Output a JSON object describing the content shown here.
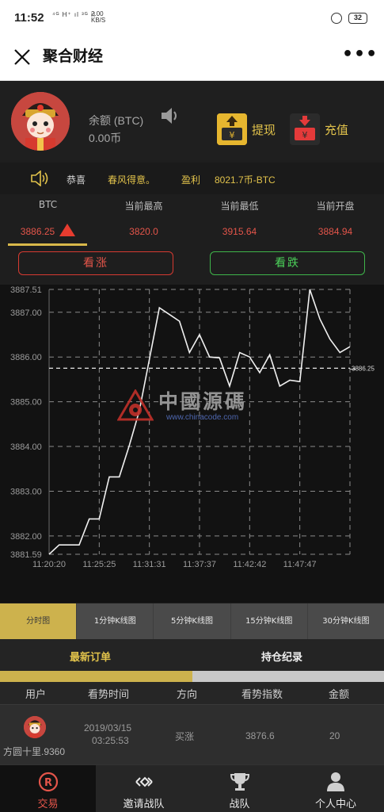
{
  "status_bar": {
    "time": "11:52",
    "network": "⁴ᴳ H⁺ ıl ³ᴳ ıl",
    "speed_top": "2.00",
    "speed_unit": "KB/S",
    "battery": "32"
  },
  "nav": {
    "title": "聚合财经",
    "more": "•••"
  },
  "account": {
    "balance_label": "余额 (BTC)",
    "balance_value": "0.00币",
    "withdraw_label": "提现",
    "recharge_label": "充值",
    "withdraw_glyph": "¥",
    "recharge_glyph": "¥"
  },
  "ticker": {
    "congrats": "恭喜",
    "user": "春风得意。",
    "profit_label": "盈利",
    "profit_value": "8021.7币-BTC"
  },
  "stats": [
    {
      "label": "BTC",
      "value": "3886.25"
    },
    {
      "label": "当前最高",
      "value": "3820.0"
    },
    {
      "label": "当前最低",
      "value": "3915.64"
    },
    {
      "label": "当前开盘",
      "value": "3884.94"
    }
  ],
  "buttons": {
    "up": "看涨",
    "down": "看跌"
  },
  "watermark": {
    "text": "中國源碼",
    "url": "www.chinacode.com"
  },
  "chart_data": {
    "type": "line",
    "y_ticks": [
      "3887.51",
      "3887.00",
      "3886.00",
      "3885.00",
      "3884.00",
      "3883.00",
      "3882.00",
      "3881.59"
    ],
    "x_ticks": [
      "11:20:20",
      "11:25:25",
      "11:31:31",
      "11:37:37",
      "11:42:42",
      "11:47:47"
    ],
    "ylim": [
      3881.59,
      3887.51
    ],
    "current_price_label": "3886.25",
    "current_price": 3885.75,
    "points": [
      3881.59,
      3881.8,
      3881.8,
      3881.8,
      3882.38,
      3882.38,
      3883.32,
      3883.32,
      3884.02,
      3884.8,
      3885.95,
      3887.1,
      3886.95,
      3886.8,
      3886.1,
      3886.5,
      3886.0,
      3885.98,
      3885.35,
      3886.1,
      3886.0,
      3885.65,
      3886.05,
      3885.35,
      3885.48,
      3885.45,
      3887.51,
      3886.85,
      3886.4,
      3886.1,
      3886.23
    ],
    "colors": {
      "line": "#f0f0f0",
      "grid": "#8a8a8a",
      "tick": "#9b9b9b"
    }
  },
  "timeframes": [
    "分时图",
    "1分钟K线图",
    "5分钟K线图",
    "15分钟K线图",
    "30分钟K线图"
  ],
  "order_tabs": {
    "latest": "最新订单",
    "holding": "持仓纪录"
  },
  "table": {
    "headers": [
      "用户",
      "看势时间",
      "方向",
      "看势指数",
      "金额"
    ],
    "row": {
      "user": "方圆十里.9360",
      "date": "2019/03/15",
      "time": "03:25:53",
      "direction": "买涨",
      "index": "3876.6",
      "amount": "20"
    }
  },
  "bottom_nav": [
    {
      "label": "交易",
      "icon": "registered-icon"
    },
    {
      "label": "邀请战队",
      "icon": "link-diamond-icon"
    },
    {
      "label": "战队",
      "icon": "trophy-icon"
    },
    {
      "label": "个人中心",
      "icon": "person-icon"
    }
  ],
  "colors": {
    "accent_gold": "#e1c24b",
    "up_red": "#e4554a",
    "down_green": "#4cd25a"
  }
}
